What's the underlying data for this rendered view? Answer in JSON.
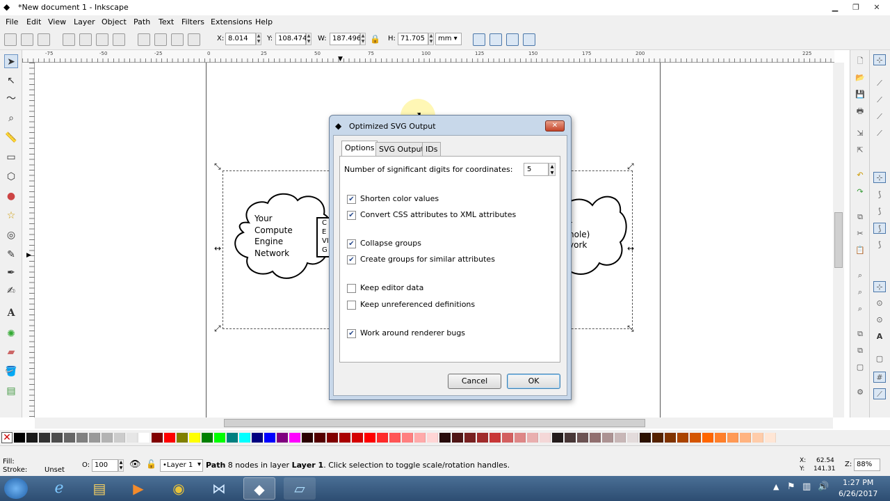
{
  "window": {
    "title": "*New document 1 - Inkscape"
  },
  "menu": [
    "File",
    "Edit",
    "View",
    "Layer",
    "Object",
    "Path",
    "Text",
    "Filters",
    "Extensions",
    "Help"
  ],
  "toolbar": {
    "x_label": "X:",
    "x_value": "8.014",
    "y_label": "Y:",
    "y_value": "108.474",
    "w_label": "W:",
    "w_value": "187.496",
    "h_label": "H:",
    "h_value": "71.705",
    "unit": "mm"
  },
  "ruler": {
    "h_ticks": [
      "-75",
      "-50",
      "-25",
      "0",
      "25",
      "50",
      "75",
      "100",
      "125",
      "150",
      "175",
      "200",
      "225"
    ],
    "v_ticks": [
      "5",
      "0",
      "5",
      "0",
      "5",
      "0",
      "5",
      "0",
      "5"
    ]
  },
  "canvas": {
    "cloud_left_text": "Your\nCompute\nEngine\nNetwork",
    "box_fragment_text": "C\nE\nVI\nG",
    "cloud_right_text": "r\nnole)\nvork"
  },
  "dialog": {
    "title": "Optimized SVG Output",
    "tabs": [
      "Options",
      "SVG Output",
      "IDs"
    ],
    "digits_label": "Number of significant digits for coordinates:",
    "digits_value": "5",
    "options": [
      {
        "label": "Shorten color values",
        "checked": true
      },
      {
        "label": "Convert CSS attributes to XML attributes",
        "checked": true
      },
      {
        "label": "Collapse groups",
        "checked": true
      },
      {
        "label": "Create groups for similar attributes",
        "checked": true
      },
      {
        "label": "Keep editor data",
        "checked": false
      },
      {
        "label": "Keep unreferenced definitions",
        "checked": false
      },
      {
        "label": "Work around renderer bugs",
        "checked": true
      }
    ],
    "cancel_label": "Cancel",
    "ok_label": "OK"
  },
  "status": {
    "fill_label": "Fill:",
    "stroke_label": "Stroke:",
    "stroke_value": "Unset",
    "opacity_label": "O:",
    "opacity_value": "100",
    "layer_value": "•Layer 1",
    "message_path": "Path",
    "message_rest": " 8 nodes in layer ",
    "message_layer": "Layer 1",
    "message_tail": ". Click selection to toggle scale/rotation handles.",
    "x_coord_label": "X:",
    "x_coord": "62.54",
    "y_coord_label": "Y:",
    "y_coord": "141.31",
    "zoom_label": "Z:",
    "zoom": "88%"
  },
  "taskbar": {
    "time": "1:27 PM",
    "date": "6/26/2017"
  },
  "palette_colors": [
    "#000000",
    "#1a1a1a",
    "#333333",
    "#4d4d4d",
    "#666666",
    "#808080",
    "#999999",
    "#b3b3b3",
    "#cccccc",
    "#e6e6e6",
    "#ffffff",
    "#800000",
    "#ff0000",
    "#808000",
    "#ffff00",
    "#008000",
    "#00ff00",
    "#008080",
    "#00ffff",
    "#000080",
    "#0000ff",
    "#800080",
    "#ff00ff",
    "#2b0000",
    "#550000",
    "#800000",
    "#aa0000",
    "#d40000",
    "#ff0000",
    "#ff2a2a",
    "#ff5555",
    "#ff8080",
    "#ffaaaa",
    "#ffd5d5",
    "#280b0b",
    "#501616",
    "#782121",
    "#a02c2c",
    "#c83737",
    "#d35f5f",
    "#de8787",
    "#e9afaf",
    "#f4d7d7",
    "#241c1c",
    "#483737",
    "#6c5353",
    "#916f6f",
    "#ac9393",
    "#c8b7b7",
    "#e3dbdb",
    "#2b1100",
    "#552200",
    "#803300",
    "#aa4400",
    "#d45500",
    "#ff6600",
    "#ff7f2a",
    "#ff9955",
    "#ffb380",
    "#ffccaa",
    "#ffe6d5"
  ]
}
